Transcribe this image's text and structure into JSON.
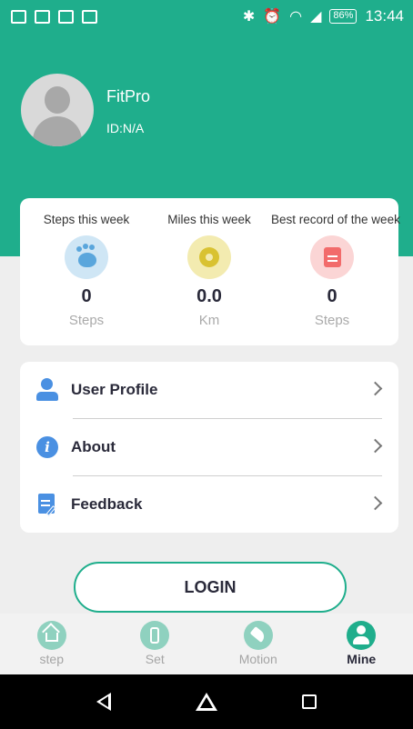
{
  "status_bar": {
    "battery": "86%",
    "time": "13:44"
  },
  "profile": {
    "app_name": "FitPro",
    "user_id": "ID:N/A"
  },
  "stats": [
    {
      "title": "Steps this week",
      "value": "0",
      "unit": "Steps",
      "icon": "footprint-icon",
      "color": "#5aa6dc"
    },
    {
      "title": "Miles this week",
      "value": "0.0",
      "unit": "Km",
      "icon": "ring-icon",
      "color": "#d9c232"
    },
    {
      "title": "Best record of the week",
      "value": "0",
      "unit": "Steps",
      "icon": "document-icon",
      "color": "#f26b6b"
    }
  ],
  "menu": [
    {
      "label": "User Profile",
      "icon": "user-icon"
    },
    {
      "label": "About",
      "icon": "info-icon"
    },
    {
      "label": "Feedback",
      "icon": "feedback-icon"
    }
  ],
  "login_label": "LOGIN",
  "tabs": [
    {
      "label": "step",
      "icon": "home-icon",
      "active": false
    },
    {
      "label": "Set",
      "icon": "watch-icon",
      "active": false
    },
    {
      "label": "Motion",
      "icon": "shoe-icon",
      "active": false
    },
    {
      "label": "Mine",
      "icon": "person-icon",
      "active": true
    }
  ],
  "colors": {
    "accent": "#1fae8c",
    "background": "#eeeeee",
    "card": "#ffffff",
    "menu_icon": "#4a90e2"
  }
}
